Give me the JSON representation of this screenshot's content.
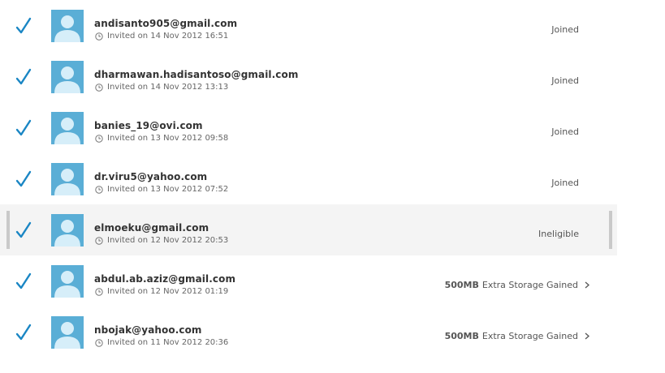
{
  "invites": [
    {
      "email": "andisanto905@gmail.com",
      "invited": "Invited on 14 Nov 2012 16:51",
      "status": "Joined"
    },
    {
      "email": "dharmawan.hadisantoso@gmail.com",
      "invited": "Invited on 14 Nov 2012 13:13",
      "status": "Joined"
    },
    {
      "email": "banies_19@ovi.com",
      "invited": "Invited on 13 Nov 2012 09:58",
      "status": "Joined"
    },
    {
      "email": "dr.viru5@yahoo.com",
      "invited": "Invited on 13 Nov 2012 07:52",
      "status": "Joined"
    },
    {
      "email": "elmoeku@gmail.com",
      "invited": "Invited on 12 Nov 2012 20:53",
      "status": "Ineligible"
    },
    {
      "email": "abdul.ab.aziz@gmail.com",
      "invited": "Invited on 12 Nov 2012 01:19",
      "reward_amount": "500MB",
      "reward_text": "Extra Storage Gained"
    },
    {
      "email": "nbojak@yahoo.com",
      "invited": "Invited on 11 Nov 2012 20:36",
      "reward_amount": "500MB",
      "reward_text": "Extra Storage Gained"
    }
  ],
  "colors": {
    "check": "#1a86c4",
    "avatar_bg": "#5aaed6",
    "avatar_fg": "#d6eef9",
    "highlight_row": "#f4f4f4"
  },
  "icons": {
    "check": "checkmark-icon",
    "avatar": "default-avatar-icon",
    "clock": "clock-icon",
    "chevron": "chevron-right-icon"
  }
}
